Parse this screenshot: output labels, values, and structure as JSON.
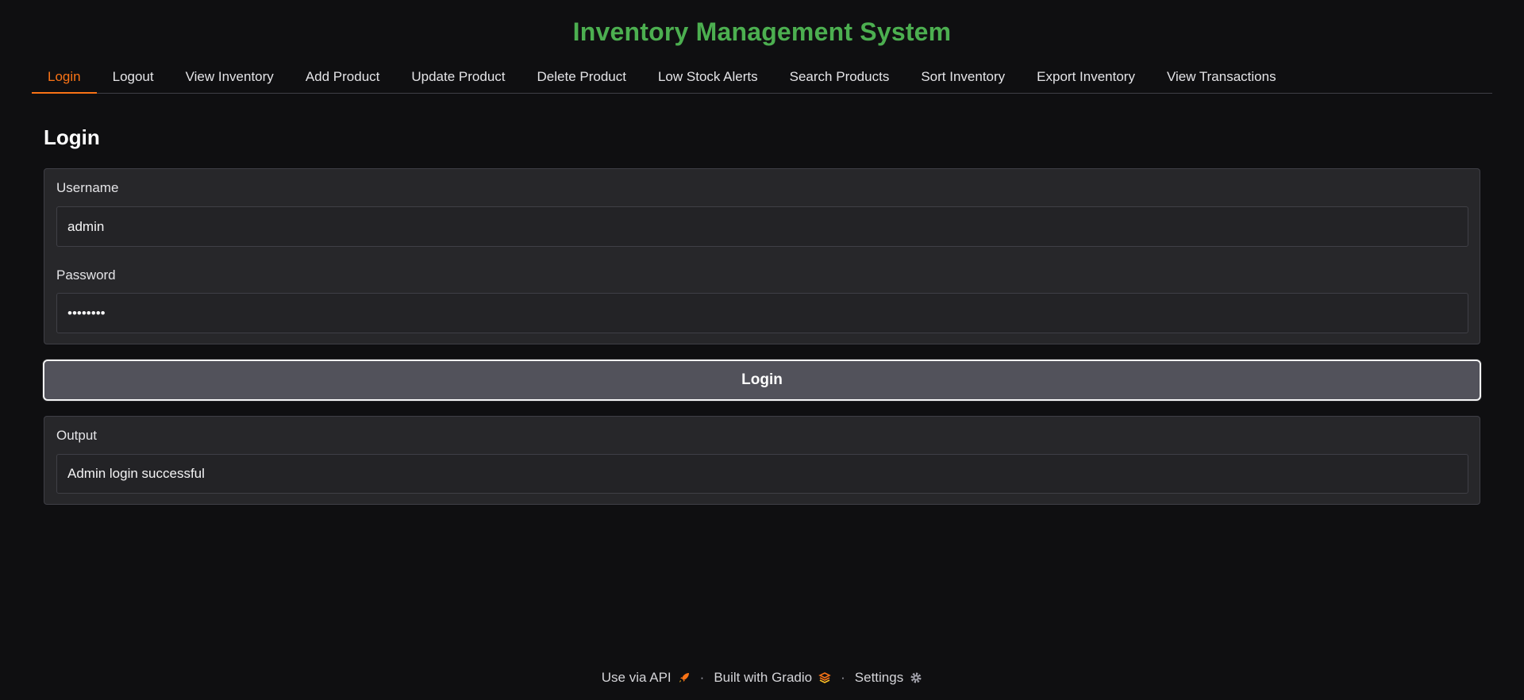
{
  "app": {
    "title": "Inventory Management System"
  },
  "tabs": [
    {
      "label": "Login",
      "active": true
    },
    {
      "label": "Logout"
    },
    {
      "label": "View Inventory"
    },
    {
      "label": "Add Product"
    },
    {
      "label": "Update Product"
    },
    {
      "label": "Delete Product"
    },
    {
      "label": "Low Stock Alerts"
    },
    {
      "label": "Search Products"
    },
    {
      "label": "Sort Inventory"
    },
    {
      "label": "Export Inventory"
    },
    {
      "label": "View Transactions"
    }
  ],
  "login": {
    "section_title": "Login",
    "username_label": "Username",
    "username_value": "admin",
    "password_label": "Password",
    "password_value": "••••••••",
    "button_label": "Login",
    "output_label": "Output",
    "output_value": "Admin login successful"
  },
  "footer": {
    "api_label": "Use via API",
    "api_icon": "rocket-icon",
    "built_label": "Built with Gradio",
    "built_icon": "gradio-logo-icon",
    "settings_label": "Settings",
    "settings_icon": "gear-icon",
    "separator": "·"
  },
  "colors": {
    "accent": "#f97316",
    "title": "#4caf50",
    "background": "#0f0f11"
  }
}
